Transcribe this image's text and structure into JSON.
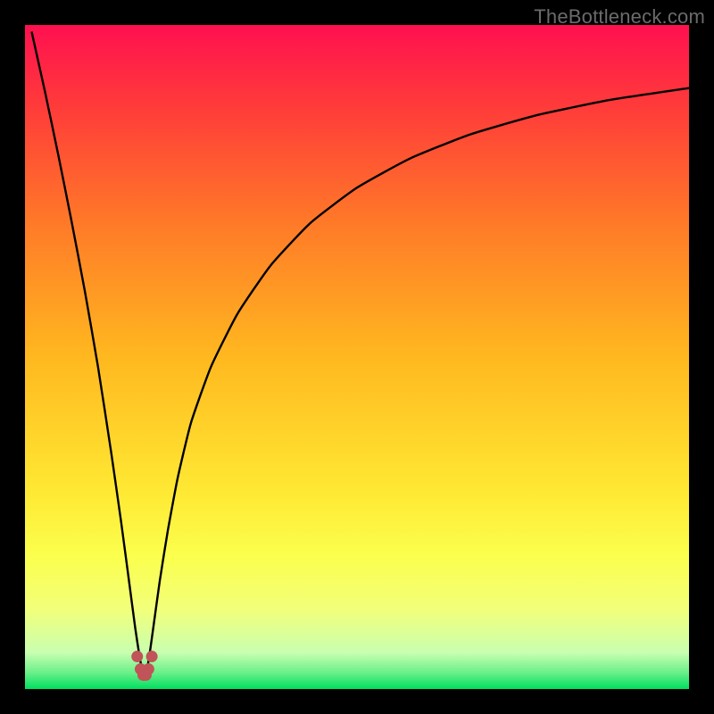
{
  "watermark": "TheBottleneck.com",
  "colors": {
    "frame": "#000000",
    "curve": "#000000",
    "marker": "#c05458",
    "gradient_stops": [
      {
        "offset": 0.0,
        "color": "#ff1050"
      },
      {
        "offset": 0.12,
        "color": "#ff3a3a"
      },
      {
        "offset": 0.3,
        "color": "#ff7a28"
      },
      {
        "offset": 0.5,
        "color": "#ffb81f"
      },
      {
        "offset": 0.7,
        "color": "#ffe833"
      },
      {
        "offset": 0.8,
        "color": "#fbff4d"
      },
      {
        "offset": 0.88,
        "color": "#f2ff7a"
      },
      {
        "offset": 0.945,
        "color": "#c9ffb0"
      },
      {
        "offset": 0.975,
        "color": "#6cf08a"
      },
      {
        "offset": 1.0,
        "color": "#00e060"
      }
    ]
  },
  "chart_data": {
    "type": "line",
    "title": "",
    "xlabel": "",
    "ylabel": "",
    "xlim": [
      0,
      100
    ],
    "ylim": [
      0,
      100
    ],
    "notch_x": 18,
    "notch_y": 2,
    "series": [
      {
        "name": "left-branch",
        "x": [
          1,
          3,
          5,
          7,
          9,
          11,
          13,
          14.5,
          15.7,
          16.6,
          17.3,
          17.8,
          18
        ],
        "values": [
          99,
          90,
          80.5,
          70.5,
          60,
          48.5,
          35.5,
          25,
          16,
          9.2,
          4.6,
          2.3,
          2
        ]
      },
      {
        "name": "right-branch",
        "x": [
          18,
          18.2,
          18.7,
          19.4,
          20.3,
          21.5,
          23,
          25,
          28,
          32,
          37,
          43,
          50,
          58,
          67,
          77,
          88,
          100
        ],
        "values": [
          2,
          2.3,
          4.8,
          9.8,
          16.3,
          23.8,
          31.8,
          40.1,
          48.5,
          56.5,
          63.8,
          70.2,
          75.5,
          79.9,
          83.5,
          86.4,
          88.7,
          90.5
        ]
      }
    ],
    "markers": {
      "name": "u-marker",
      "x": [
        16.9,
        17.4,
        17.8,
        18.2,
        18.6,
        19.1
      ],
      "values": [
        4.9,
        3.0,
        2.1,
        2.1,
        3.0,
        4.9
      ]
    }
  }
}
